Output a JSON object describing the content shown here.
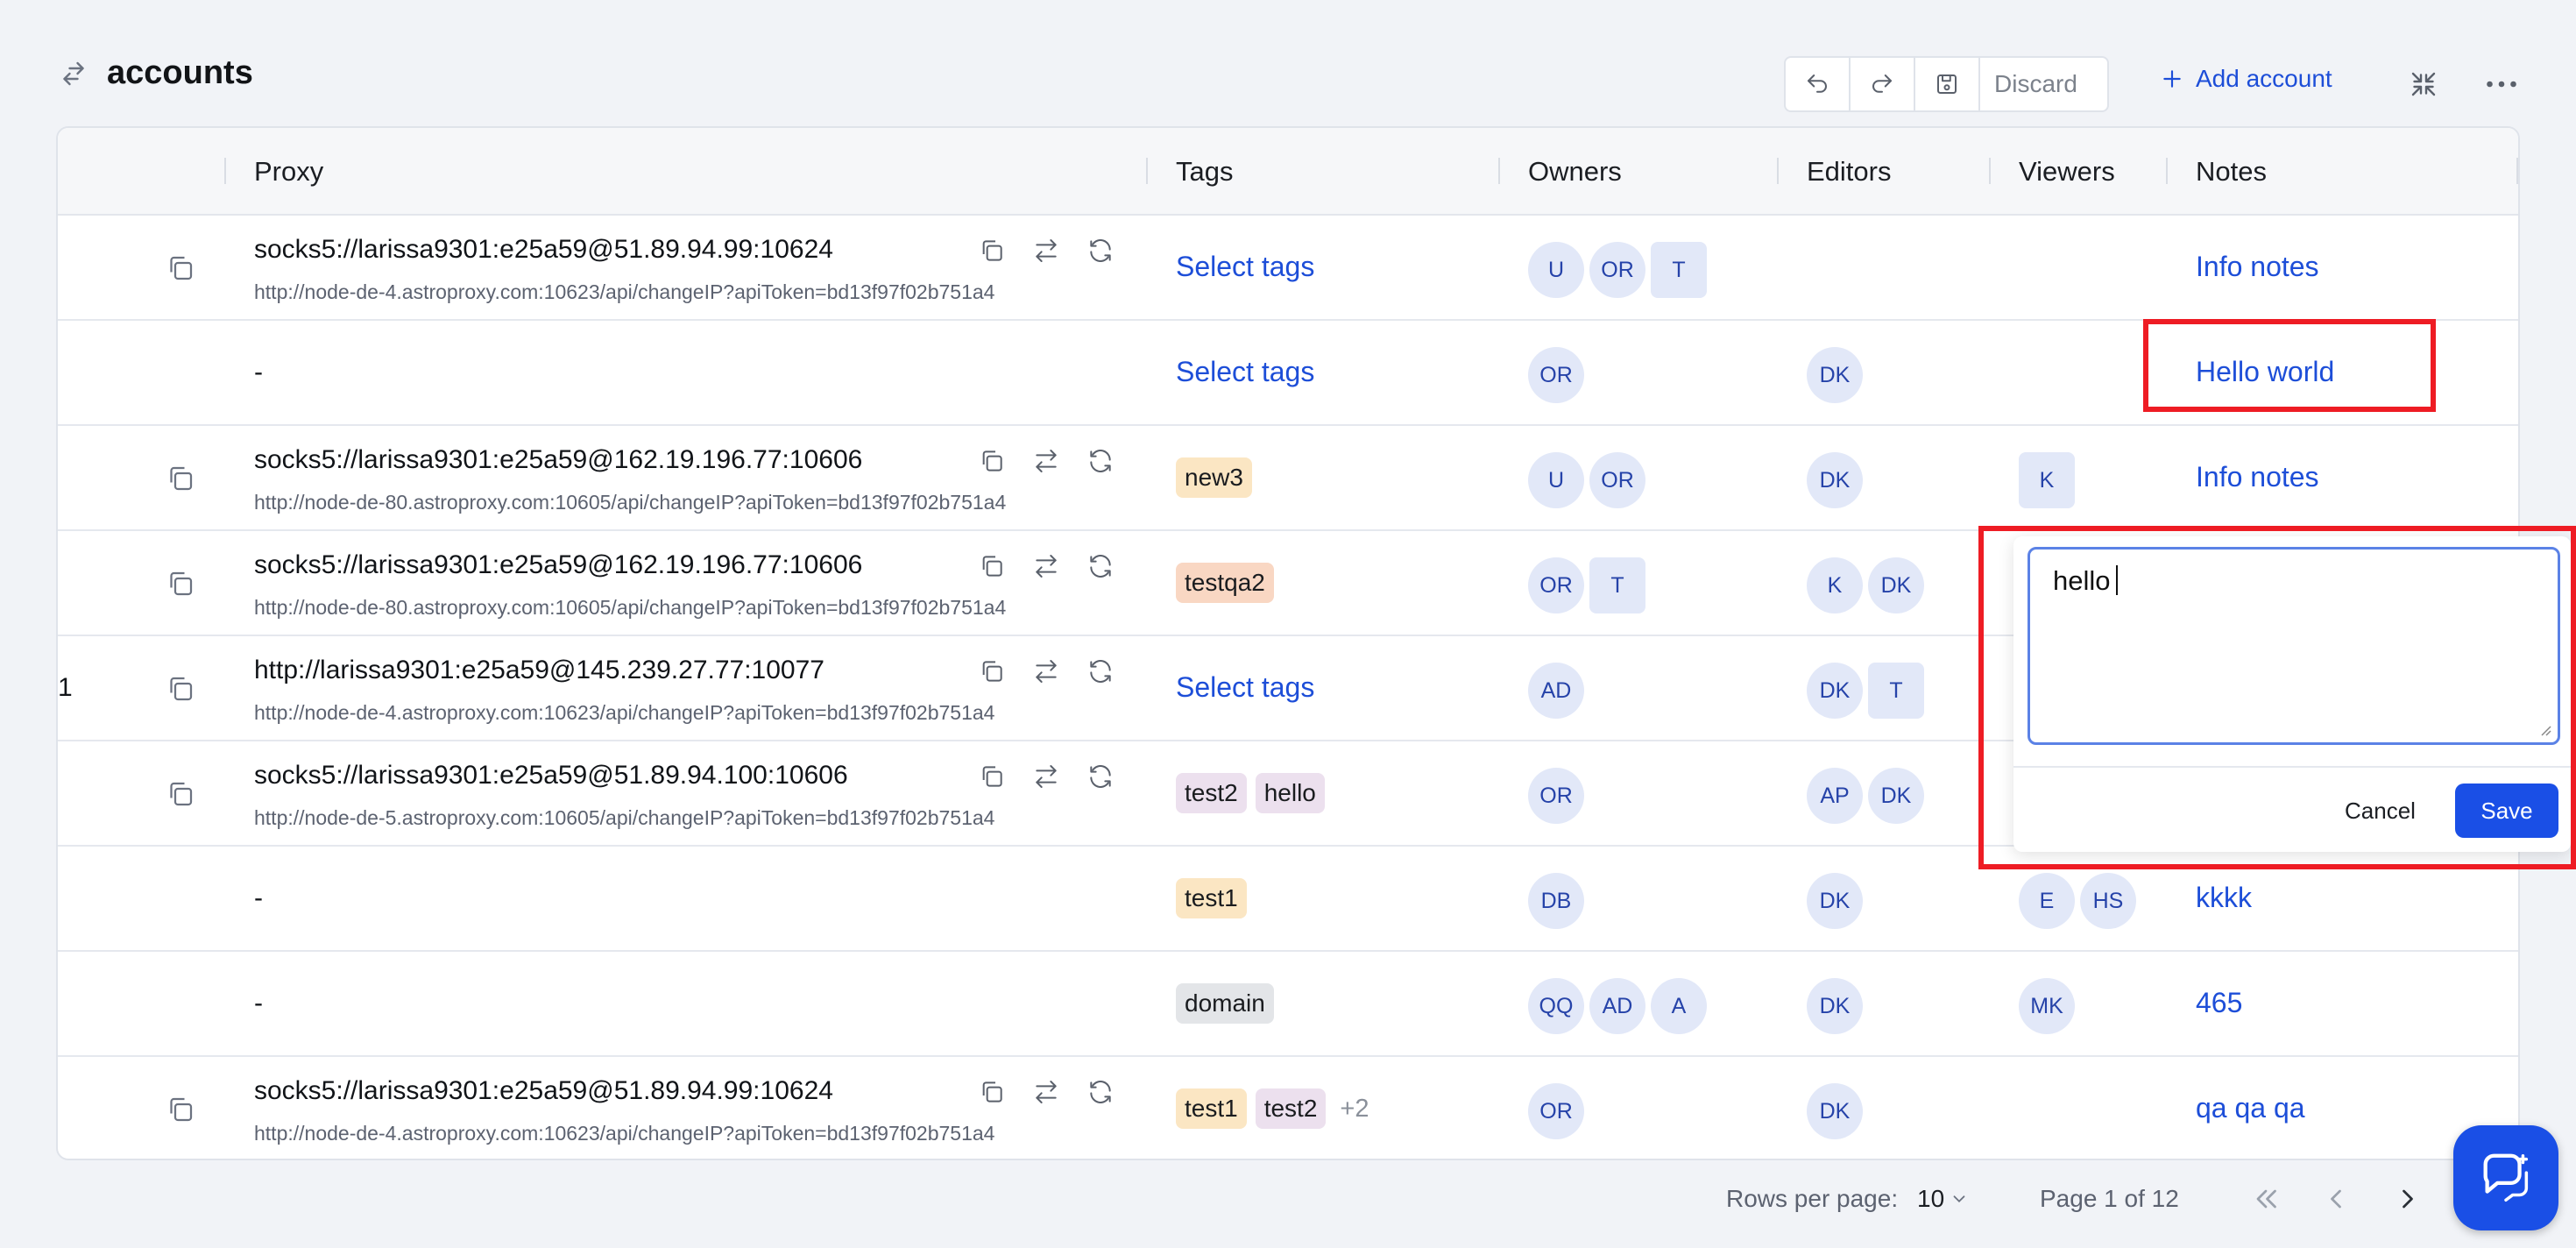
{
  "header": {
    "title": "accounts",
    "discard_label": "Discard",
    "add_account_label": "Add account"
  },
  "table": {
    "columns": {
      "proxy": "Proxy",
      "tags": "Tags",
      "owners": "Owners",
      "editors": "Editors",
      "viewers": "Viewers",
      "notes": "Notes"
    },
    "select_tags_label": "Select tags",
    "rows": [
      {
        "proxy": "socks5://larissa9301:e25a59@51.89.94.99:10624",
        "change_url": "http://node-de-4.astroproxy.com:10623/api/changeIP?apiToken=bd13f97f02b751a4",
        "tags": [],
        "owners": [
          "U",
          "OR",
          "T"
        ],
        "editors": [],
        "viewers": [],
        "note": "Info notes"
      },
      {
        "proxy": "-",
        "tags": [],
        "owners": [
          "OR"
        ],
        "editors": [
          "DK"
        ],
        "viewers": [],
        "note": "Hello world"
      },
      {
        "proxy": "socks5://larissa9301:e25a59@162.19.196.77:10606",
        "change_url": "http://node-de-80.astroproxy.com:10605/api/changeIP?apiToken=bd13f97f02b751a4",
        "tags": [
          "new3"
        ],
        "owners": [
          "U",
          "OR"
        ],
        "editors": [
          "DK"
        ],
        "viewers": [
          "K"
        ],
        "note": "Info notes"
      },
      {
        "proxy": "socks5://larissa9301:e25a59@162.19.196.77:10606",
        "change_url": "http://node-de-80.astroproxy.com:10605/api/changeIP?apiToken=bd13f97f02b751a4",
        "tags": [
          "testqa2"
        ],
        "owners": [
          "OR",
          "T"
        ],
        "editors": [
          "K",
          "DK"
        ],
        "viewers": [],
        "note": ""
      },
      {
        "row_number": "1",
        "proxy": "http://larissa9301:e25a59@145.239.27.77:10077",
        "change_url": "http://node-de-4.astroproxy.com:10623/api/changeIP?apiToken=bd13f97f02b751a4",
        "tags": [],
        "owners": [
          "AD"
        ],
        "editors": [
          "DK",
          "T"
        ],
        "viewers": [],
        "note": ""
      },
      {
        "proxy": "socks5://larissa9301:e25a59@51.89.94.100:10606",
        "change_url": "http://node-de-5.astroproxy.com:10605/api/changeIP?apiToken=bd13f97f02b751a4",
        "tags": [
          "test2",
          "hello"
        ],
        "owners": [
          "OR"
        ],
        "editors": [
          "AP",
          "DK"
        ],
        "viewers": [],
        "note": ""
      },
      {
        "proxy": "-",
        "tags": [
          "test1"
        ],
        "owners": [
          "DB"
        ],
        "editors": [
          "DK"
        ],
        "viewers": [
          "E",
          "HS"
        ],
        "note": "kkkk"
      },
      {
        "proxy": "-",
        "tags": [
          "domain"
        ],
        "owners": [
          "QQ",
          "AD",
          "A"
        ],
        "editors": [
          "DK"
        ],
        "viewers": [
          "MK"
        ],
        "note": "465"
      },
      {
        "proxy": "socks5://larissa9301:e25a59@51.89.94.99:10624",
        "change_url": "http://node-de-4.astroproxy.com:10623/api/changeIP?apiToken=bd13f97f02b751a4",
        "tags": [
          "test1",
          "test2"
        ],
        "tags_more": "+2",
        "owners": [
          "OR"
        ],
        "editors": [
          "DK"
        ],
        "viewers": [],
        "note": "qa qa qa"
      }
    ]
  },
  "note_editor": {
    "value": "hello",
    "cancel_label": "Cancel",
    "save_label": "Save"
  },
  "pagination": {
    "rows_per_page_label": "Rows per page:",
    "rows_per_page_value": "10",
    "page_info": "Page 1 of 12"
  },
  "colors": {
    "accent": "#1a4fe6",
    "link": "#1d4ed8",
    "highlight": "#ee1c24",
    "avatar_bg": "#e2e8f8",
    "tag_new3": "#fbe6c3",
    "tag_testqa2": "#f9d7c3",
    "tag_test2": "#ece0ee",
    "tag_hello": "#ece0ee",
    "tag_test1": "#fbe6c3",
    "tag_domain": "#e3e5e8"
  }
}
